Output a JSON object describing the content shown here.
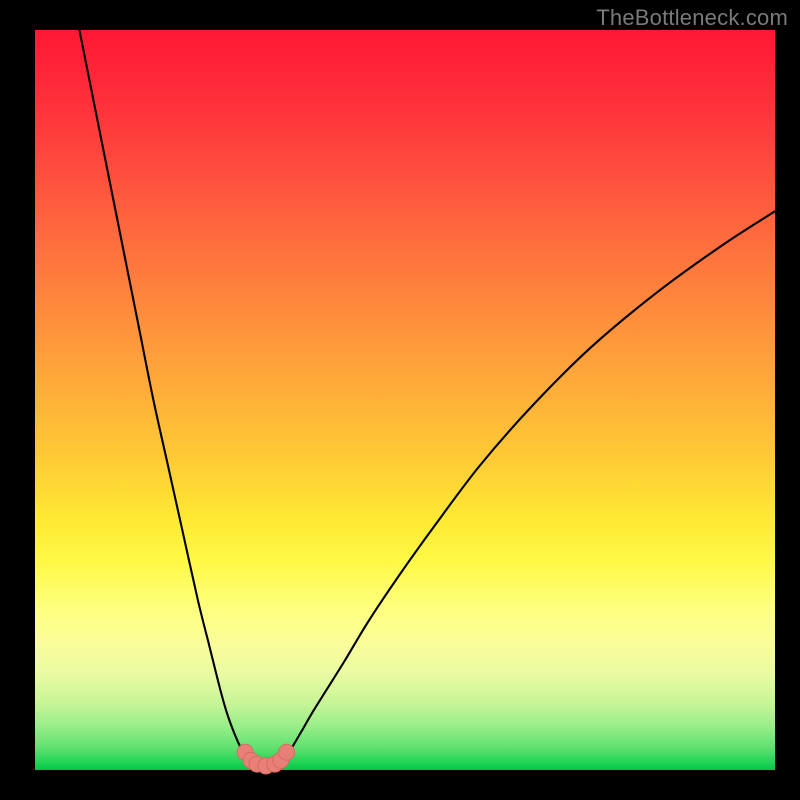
{
  "watermark": "TheBottleneck.com",
  "colors": {
    "frame": "#000000",
    "gradient_top": "#ff1834",
    "gradient_mid1": "#ff8b3c",
    "gradient_mid2": "#ffe933",
    "gradient_bottom": "#02c648",
    "curve": "#000000",
    "marker_fill": "#e88078",
    "marker_stroke": "#d96a62"
  },
  "chart_data": {
    "type": "line",
    "title": "",
    "xlabel": "",
    "ylabel": "",
    "xlim": [
      0,
      100
    ],
    "ylim": [
      0,
      100
    ],
    "grid": false,
    "legend": false,
    "annotations": [],
    "series": [
      {
        "name": "left-branch",
        "x": [
          6,
          8,
          10,
          12,
          14,
          16,
          18,
          20,
          22,
          23.5,
          25,
          26,
          27,
          27.8,
          28.5,
          29,
          29.5
        ],
        "y": [
          100,
          90,
          80,
          70,
          60,
          50,
          41,
          32,
          23,
          17,
          11,
          7.5,
          4.8,
          3.0,
          1.8,
          1.1,
          0.8
        ]
      },
      {
        "name": "right-branch",
        "x": [
          33,
          33.5,
          34.2,
          35,
          36,
          37.5,
          39.5,
          42,
          45,
          49,
          54,
          60,
          67,
          75,
          84,
          93,
          100
        ],
        "y": [
          0.8,
          1.3,
          2.2,
          3.5,
          5.2,
          7.8,
          11,
          15,
          20,
          26,
          33,
          41,
          49,
          57,
          64.5,
          71,
          75.5
        ]
      },
      {
        "name": "valley-markers",
        "x": [
          28.4,
          29.2,
          30.0,
          31.2,
          32.4,
          33.2,
          34.0
        ],
        "y": [
          2.4,
          1.3,
          0.8,
          0.55,
          0.8,
          1.3,
          2.4
        ]
      },
      {
        "name": "valley-arc",
        "x": [
          29.5,
          30.0,
          30.6,
          31.2,
          31.8,
          32.4,
          33.0
        ],
        "y": [
          0.8,
          0.62,
          0.55,
          0.52,
          0.55,
          0.62,
          0.8
        ]
      }
    ]
  }
}
